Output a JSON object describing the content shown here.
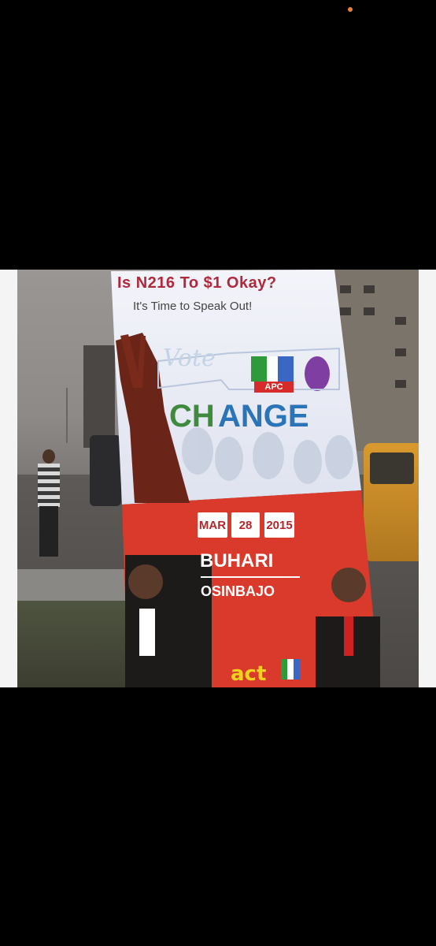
{
  "photo": {
    "banner": {
      "headline": "Is N216 To $1 Okay?",
      "subline": "It's Time to Speak Out!",
      "vote_word": "Vote",
      "party_logo": "APC",
      "slogan_green": "CH",
      "slogan_blue": "ANGE",
      "date_month": "MAR",
      "date_day": "28",
      "date_year": "2015",
      "candidate_1": "BUHARI",
      "candidate_2": "OSINBAJO",
      "sponsor": "act"
    },
    "colors": {
      "banner_top": "#eef0f8",
      "banner_bottom": "#d93a2b",
      "headline": "#b0283b",
      "change_green": "#3f8a3f",
      "change_blue": "#2a74b8",
      "act_yellow": "#f2d21f"
    }
  }
}
